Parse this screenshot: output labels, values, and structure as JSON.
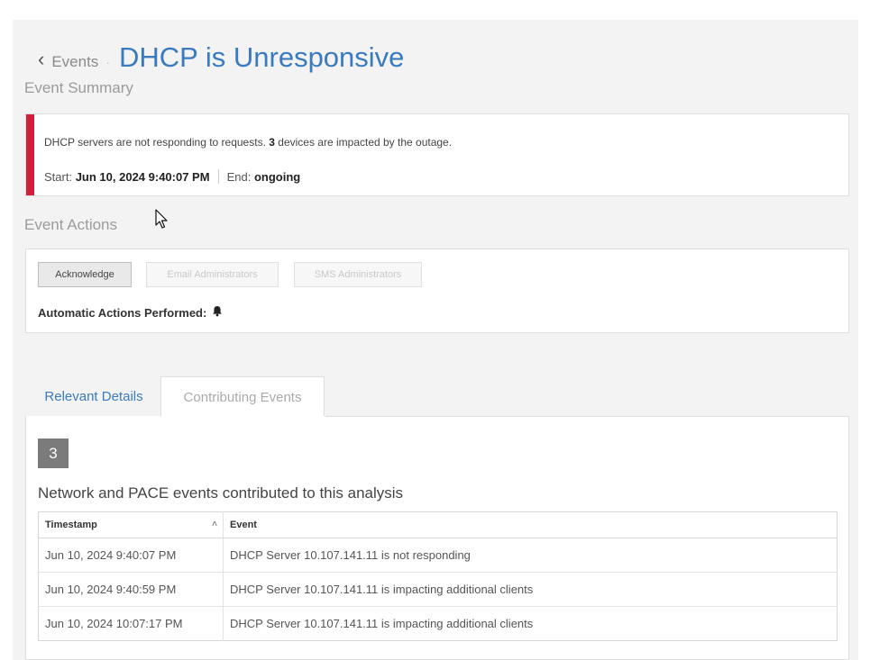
{
  "header": {
    "back_label": "Events",
    "title": "DHCP is Unresponsive"
  },
  "summary": {
    "section_title": "Event Summary",
    "text_prefix": "DHCP servers are not responding to requests.",
    "impacted_count": "3",
    "text_suffix": "devices are impacted by the outage.",
    "start_label": "Start:",
    "start_value": "Jun 10, 2024 9:40:07 PM",
    "end_label": "End:",
    "end_value": "ongoing",
    "accent_color": "#d01f3c"
  },
  "actions": {
    "section_title": "Event Actions",
    "acknowledge_label": "Acknowledge",
    "email_label": "Email Administrators",
    "sms_label": "SMS Administrators",
    "automatic_label": "Automatic Actions Performed:",
    "automatic_icon": "bell-icon"
  },
  "tabs": {
    "relevant_label": "Relevant Details",
    "contributing_label": "Contributing Events"
  },
  "contributing": {
    "count": "3",
    "heading": "Network and PACE events contributed to this analysis",
    "columns": {
      "timestamp": "Timestamp",
      "event": "Event"
    },
    "rows": [
      {
        "timestamp": "Jun 10, 2024 9:40:07 PM",
        "event": "DHCP Server 10.107.141.11 is not responding"
      },
      {
        "timestamp": "Jun 10, 2024 9:40:59 PM",
        "event": "DHCP Server 10.107.141.11 is impacting additional clients"
      },
      {
        "timestamp": "Jun 10, 2024 10:07:17 PM",
        "event": "DHCP Server 10.107.141.11 is impacting additional clients"
      }
    ]
  },
  "colors": {
    "title_blue": "#3a7bbf",
    "badge_gray": "#7b7b7b"
  }
}
